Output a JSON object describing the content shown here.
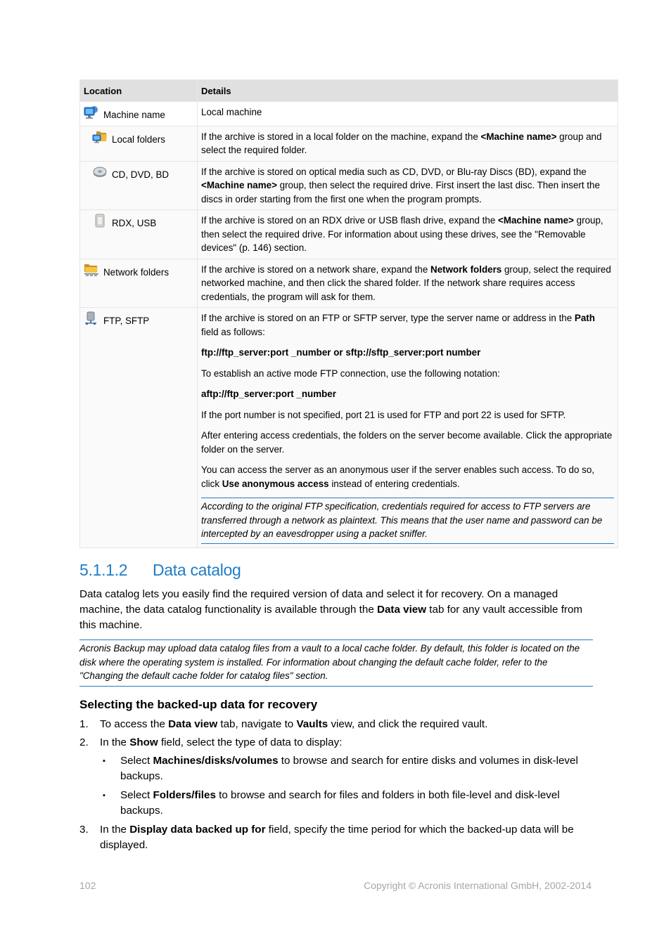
{
  "table": {
    "headers": [
      "Location",
      "Details"
    ],
    "rows": [
      {
        "icon": "monitor-icon",
        "location": "Machine name",
        "details": [
          {
            "type": "text",
            "parts": [
              {
                "t": "Local machine"
              }
            ]
          }
        ]
      },
      {
        "icon": "local-folder-icon",
        "location": "Local folders",
        "details": [
          {
            "type": "text",
            "parts": [
              {
                "t": "If the archive is stored in a local folder on the machine, expand the "
              },
              {
                "t": "<Machine name>",
                "b": true
              },
              {
                "t": " group and select the required folder."
              }
            ]
          }
        ]
      },
      {
        "icon": "optical-disc-icon",
        "location": "CD, DVD, BD",
        "details": [
          {
            "type": "text",
            "parts": [
              {
                "t": "If the archive is stored on optical media such as CD, DVD, or Blu-ray Discs (BD), expand the "
              },
              {
                "t": "<Machine name>",
                "b": true
              },
              {
                "t": " group, then select the required drive. First insert the last disc. Then insert the discs in order starting from the first one when the program prompts."
              }
            ]
          }
        ]
      },
      {
        "icon": "usb-drive-icon",
        "location": "RDX, USB",
        "details": [
          {
            "type": "text",
            "parts": [
              {
                "t": "If the archive is stored on an RDX drive or USB flash drive, expand the "
              },
              {
                "t": "<Machine name>",
                "b": true
              },
              {
                "t": " group, then select the required drive. For information about using these drives, see the \"Removable devices\" (p. 146) section."
              }
            ]
          }
        ]
      },
      {
        "icon": "network-folder-icon",
        "location": "Network folders",
        "details": [
          {
            "type": "text",
            "parts": [
              {
                "t": "If the archive is stored on a network share, expand the "
              },
              {
                "t": "Network folders",
                "b": true
              },
              {
                "t": " group, select the required networked machine, and then click the shared folder. If the network share requires access credentials, the program will ask for them."
              }
            ]
          }
        ]
      },
      {
        "icon": "ftp-server-icon",
        "location": "FTP, SFTP",
        "details": [
          {
            "type": "text",
            "parts": [
              {
                "t": "If the archive is stored on an FTP or SFTP server, type the server name or address in the "
              },
              {
                "t": "Path",
                "b": true
              },
              {
                "t": " field as follows:"
              }
            ]
          },
          {
            "type": "text",
            "parts": [
              {
                "t": "ftp://ftp_server:port _number or sftp://sftp_server:port number",
                "b": true
              }
            ]
          },
          {
            "type": "text",
            "parts": [
              {
                "t": "To establish an active mode FTP connection, use the following notation:"
              }
            ]
          },
          {
            "type": "text",
            "parts": [
              {
                "t": "aftp://ftp_server:port _number",
                "b": true
              }
            ]
          },
          {
            "type": "text",
            "parts": [
              {
                "t": "If the port number is not specified, port 21 is used for FTP and port 22 is used for SFTP."
              }
            ]
          },
          {
            "type": "text",
            "parts": [
              {
                "t": "After entering access credentials, the folders on the server become available. Click the appropriate folder on the server."
              }
            ]
          },
          {
            "type": "text",
            "parts": [
              {
                "t": "You can access the server as an anonymous user if the server enables such access. To do so, click "
              },
              {
                "t": "Use anonymous access",
                "b": true
              },
              {
                "t": " instead of entering credentials."
              }
            ]
          },
          {
            "type": "note",
            "parts": [
              {
                "t": "According to the original FTP specification, credentials required for access to FTP servers are transferred through a network as plaintext. This means that the user name and password can be intercepted by an eavesdropper using a packet sniffer."
              }
            ]
          }
        ]
      }
    ]
  },
  "section": {
    "number": "5.1.1.2",
    "title": "Data catalog",
    "intro_parts": [
      {
        "t": "Data catalog lets you easily find the required version of data and select it for recovery. On a managed machine, the data catalog functionality is available through the "
      },
      {
        "t": "Data view",
        "b": true
      },
      {
        "t": " tab for any vault accessible from this machine."
      }
    ],
    "note": "Acronis Backup may upload data catalog files from a vault to a local cache folder. By default, this folder is located on the disk where the operating system is installed. For information about changing the default cache folder, refer to the \"Changing the default cache folder for catalog files\" section.",
    "subheading": "Selecting the backed-up data for recovery",
    "steps": [
      {
        "n": "1.",
        "parts": [
          {
            "t": "To access the "
          },
          {
            "t": "Data view",
            "b": true
          },
          {
            "t": " tab, navigate to "
          },
          {
            "t": "Vaults",
            "b": true
          },
          {
            "t": " view, and click the required vault."
          }
        ]
      },
      {
        "n": "2.",
        "parts": [
          {
            "t": "In the "
          },
          {
            "t": "Show",
            "b": true
          },
          {
            "t": " field, select the type of data to display:"
          }
        ],
        "bullets": [
          [
            {
              "t": "Select "
            },
            {
              "t": "Machines/disks/volumes",
              "b": true
            },
            {
              "t": " to browse and search for entire disks and volumes in disk-level backups."
            }
          ],
          [
            {
              "t": "Select "
            },
            {
              "t": "Folders/files",
              "b": true
            },
            {
              "t": " to browse and search for files and folders in both file-level and disk-level backups."
            }
          ]
        ]
      },
      {
        "n": "3.",
        "parts": [
          {
            "t": "In the "
          },
          {
            "t": "Display data backed up for",
            "b": true
          },
          {
            "t": " field, specify the time period for which the backed-up data will be displayed."
          }
        ]
      }
    ]
  },
  "footer": {
    "page_number": "102",
    "copyright": "Copyright © Acronis International GmbH, 2002-2014"
  }
}
